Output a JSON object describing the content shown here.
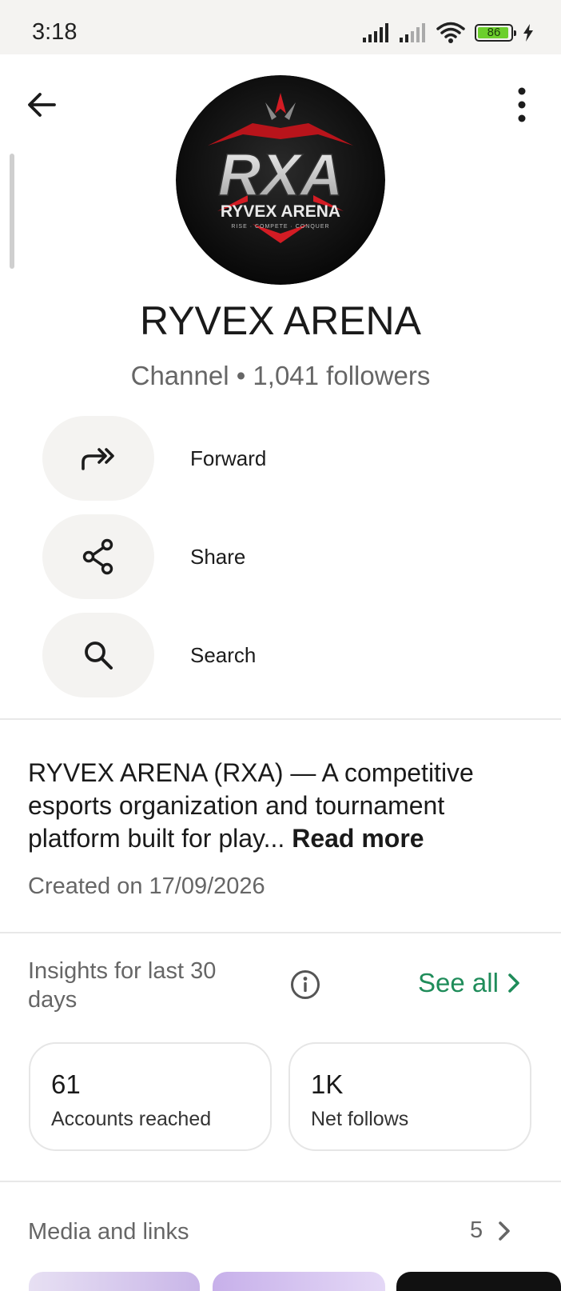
{
  "status_bar": {
    "time": "3:18",
    "battery_level": "86"
  },
  "channel": {
    "avatar": {
      "logo_text": "RXA",
      "logo_name": "RYVEX ARENA",
      "logo_tagline": "RISE · COMPETE · CONQUER"
    },
    "name": "RYVEX ARENA",
    "subtitle": "Channel • 1,041 followers"
  },
  "actions": [
    {
      "icon": "forward-icon",
      "label": "Forward"
    },
    {
      "icon": "share-icon",
      "label": "Share"
    },
    {
      "icon": "search-icon",
      "label": "Search"
    }
  ],
  "description": {
    "text": "RYVEX ARENA (RXA) — A competitive esports organization and tournament platform built for play... ",
    "read_more": "Read more",
    "created": "Created on 17/09/2026"
  },
  "insights": {
    "title": "Insights for last 30 days",
    "see_all": "See all",
    "cards": [
      {
        "value": "61",
        "label": "Accounts reached"
      },
      {
        "value": "1K",
        "label": "Net follows"
      }
    ]
  },
  "media": {
    "title": "Media and links",
    "count": "5"
  },
  "colors": {
    "accent_green": "#1f8c5a",
    "battery_green": "#6ccf2c",
    "logo_red": "#d31c24",
    "surface": "#f4f3f1"
  }
}
